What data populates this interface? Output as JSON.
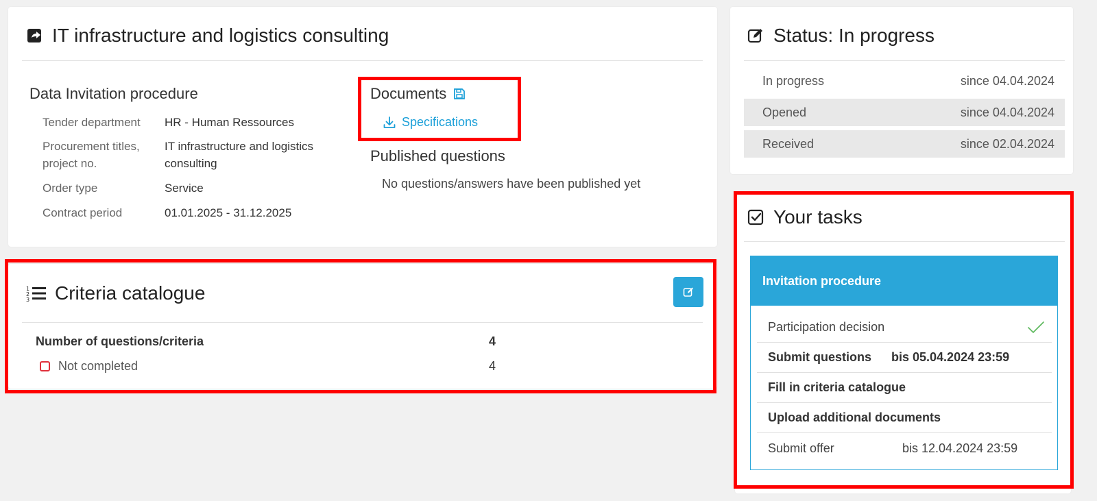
{
  "tender": {
    "title": "IT infrastructure and logistics consulting",
    "data_heading": "Data Invitation procedure",
    "fields": [
      {
        "label": "Tender department",
        "value": "HR - Human Ressources"
      },
      {
        "label": "Procurement titles, project no.",
        "value": "IT infrastructure and logistics consulting"
      },
      {
        "label": "Order type",
        "value": "Service"
      },
      {
        "label": "Contract period",
        "value": "01.01.2025 - 31.12.2025"
      }
    ],
    "documents_heading": "Documents",
    "documents": [
      {
        "label": "Specifications"
      }
    ],
    "published_heading": "Published questions",
    "published_text": "No questions/answers have been published yet"
  },
  "criteria": {
    "title": "Criteria catalogue",
    "rows": [
      {
        "label": "Number of questions/criteria",
        "value": "4"
      },
      {
        "label": "Not completed",
        "value": "4"
      }
    ]
  },
  "status": {
    "title": "Status: In progress",
    "rows": [
      {
        "label": "In progress",
        "since": "since 04.04.2024"
      },
      {
        "label": "Opened",
        "since": "since 04.04.2024"
      },
      {
        "label": "Received",
        "since": "since 02.04.2024"
      }
    ]
  },
  "tasks": {
    "title": "Your tasks",
    "group": "Invitation procedure",
    "items": [
      {
        "label": "Participation decision",
        "due": "",
        "done": true
      },
      {
        "label": "Submit questions",
        "due": "bis 05.04.2024 23:59"
      },
      {
        "label": "Fill in criteria catalogue",
        "due": ""
      },
      {
        "label": "Upload additional documents",
        "due": ""
      },
      {
        "label": "Submit offer",
        "due": "bis 12.04.2024 23:59"
      }
    ]
  },
  "colors": {
    "accent": "#2aa6d9",
    "highlight": "#ff0000",
    "check": "#5cb85c",
    "incomplete": "#e0303b"
  }
}
